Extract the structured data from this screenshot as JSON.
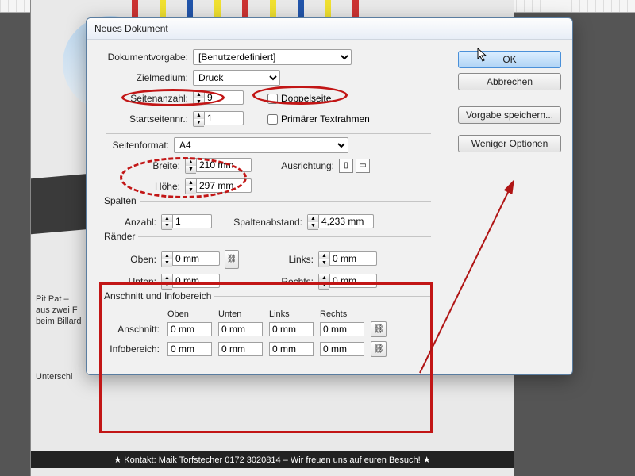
{
  "background": {
    "sidebar_text_1": "Pit Pat –",
    "sidebar_text_2": "aus zwei F",
    "sidebar_text_3": "beim Billard",
    "sidebar_text_4": "Unterschi",
    "footer": "★ Kontakt: Maik Torfstecher 0172 3020814 – Wir freuen uns auf euren Besuch! ★"
  },
  "dialog": {
    "title": "Neues Dokument",
    "preset_label": "Dokumentvorgabe:",
    "preset_value": "[Benutzerdefiniert]",
    "medium_label": "Zielmedium:",
    "medium_value": "Druck",
    "pages_label": "Seitenanzahl:",
    "pages_value": "9",
    "facing_label": "Doppelseite",
    "startpage_label": "Startseitennr.:",
    "startpage_value": "1",
    "primary_label": "Primärer Textrahmen",
    "pagesize_label": "Seitenformat:",
    "pagesize_value": "A4",
    "width_label": "Breite:",
    "width_value": "210 mm",
    "height_label": "Höhe:",
    "height_value": "297 mm",
    "orient_label": "Ausrichtung:",
    "columns_section": "Spalten",
    "colcount_label": "Anzahl:",
    "colcount_value": "1",
    "gutter_label": "Spaltenabstand:",
    "gutter_value": "4,233 mm",
    "margins_section": "Ränder",
    "top_label": "Oben:",
    "bottom_label": "Unten:",
    "left_label": "Links:",
    "right_label": "Rechts:",
    "margin_value": "0 mm",
    "bleed_section": "Anschnitt und Infobereich",
    "hdr_top": "Oben",
    "hdr_bottom": "Unten",
    "hdr_left": "Links",
    "hdr_right": "Rechts",
    "bleed_label": "Anschnitt:",
    "slug_label": "Infobereich:",
    "zero": "0 mm",
    "buttons": {
      "ok": "OK",
      "cancel": "Abbrechen",
      "save_preset": "Vorgabe speichern...",
      "fewer": "Weniger Optionen"
    }
  }
}
